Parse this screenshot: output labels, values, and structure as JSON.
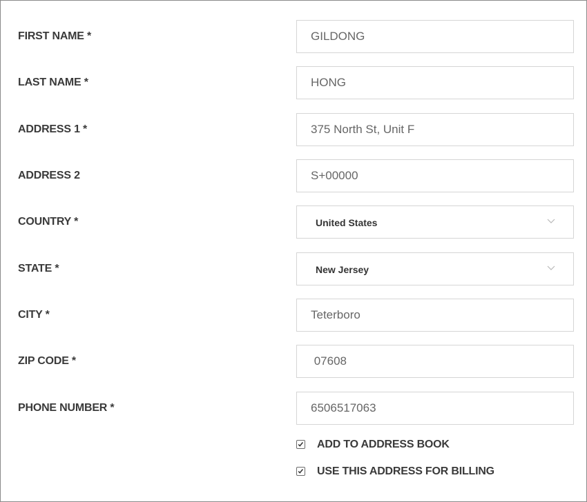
{
  "form": {
    "fields": [
      {
        "label": "FIRST NAME *",
        "value": "GILDONG"
      },
      {
        "label": "LAST NAME *",
        "value": "HONG"
      },
      {
        "label": "ADDRESS 1 *",
        "value": "375 North St, Unit F"
      },
      {
        "label": "ADDRESS 2",
        "value": "S+00000"
      },
      {
        "label": "COUNTRY *",
        "value": "United States"
      },
      {
        "label": "STATE *",
        "value": "New Jersey"
      },
      {
        "label": "CITY *",
        "value": "Teterboro"
      },
      {
        "label": "ZIP CODE *",
        "value": " 07608"
      },
      {
        "label": "PHONE NUMBER *",
        "value": "6506517063"
      }
    ],
    "checkboxes": [
      {
        "label": "ADD TO ADDRESS BOOK",
        "checked": true
      },
      {
        "label": "USE THIS ADDRESS FOR BILLING",
        "checked": true
      }
    ]
  },
  "icons": {
    "select_arrow": "chevron-down-icon",
    "checkmark": "checkmark-icon"
  },
  "colors": {
    "label_text": "#3a3a3a",
    "input_text": "#666666",
    "input_border": "#d5d5d5",
    "frame_border": "#8a8a8a"
  }
}
